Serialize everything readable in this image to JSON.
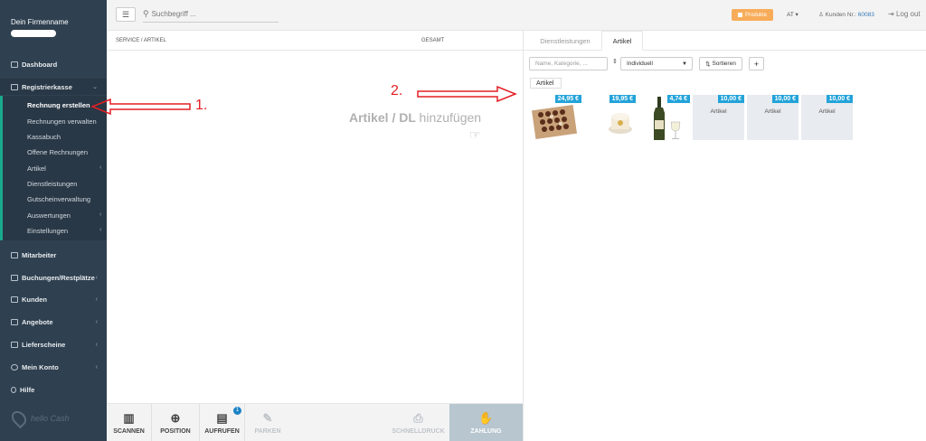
{
  "sidebar": {
    "company_name": "Dein Firmenname",
    "items": {
      "dashboard": "Dashboard",
      "registrierkasse": "Registrierkasse",
      "mitarbeiter": "Mitarbeiter",
      "buchungen": "Buchungen/Restplätze",
      "kunden": "Kunden",
      "angebote": "Angebote",
      "lieferscheine": "Lieferscheine",
      "mein_konto": "Mein Konto",
      "hilfe": "Hilfe"
    },
    "sub_items": {
      "rechnung_erstellen": "Rechnung erstellen",
      "rechnungen_verwalten": "Rechnungen verwalten",
      "kassabuch": "Kassabuch",
      "offene_rechnungen": "Offene Rechnungen",
      "artikel": "Artikel",
      "dienstleistungen": "Dienstleistungen",
      "gutscheinverwaltung": "Gutscheinverwaltung",
      "auswertungen": "Auswertungen",
      "einstellungen": "Einstellungen"
    },
    "logo_text": "hello Cash"
  },
  "topbar": {
    "search_placeholder": "Suchbegriff ...",
    "produkte_label": "Produkte",
    "language": "AT",
    "kunden_label": "Kunden Nr.:",
    "kunden_number": "60083",
    "logout_label": "Log out"
  },
  "left_panel": {
    "col_service": "SERVICE / ARTIKEL",
    "col_gesamt": "GESAMT",
    "hint_bold": "Artikel / DL",
    "hint_light": "hinzufügen"
  },
  "annotations": {
    "step1": "1.",
    "step2": "2."
  },
  "bottombar": {
    "scannen": "SCANNEN",
    "position": "POSITION",
    "aufrufen": "AUFRUFEN",
    "aufrufen_badge": "1",
    "parken": "PARKEN",
    "schnelldruck": "SCHNELLDRUCK",
    "zahlung": "ZAHLUNG"
  },
  "right_panel": {
    "tab_dienstleistungen": "Dienstleistungen",
    "tab_artikel": "Artikel",
    "filter_placeholder": "Name, Kategorie, ...",
    "select_value": "Individuell",
    "sort_label": "Sortieren",
    "plus_label": "+",
    "breadcrumb": "Artikel",
    "tiles": [
      {
        "price": "24,95 €",
        "label": ""
      },
      {
        "price": "19,95 €",
        "label": ""
      },
      {
        "price": "4,74 €",
        "label": ""
      },
      {
        "price": "10,00 €",
        "label": "Artikel"
      },
      {
        "price": "10,00 €",
        "label": "Artikel"
      },
      {
        "price": "10,00 €",
        "label": "Artikel"
      }
    ]
  },
  "colors": {
    "sidebar": "#2f4050",
    "accent": "#19aa8d",
    "price_badge": "#23a3d9",
    "produkte": "#f8ac59",
    "annotation": "#e31e24"
  }
}
